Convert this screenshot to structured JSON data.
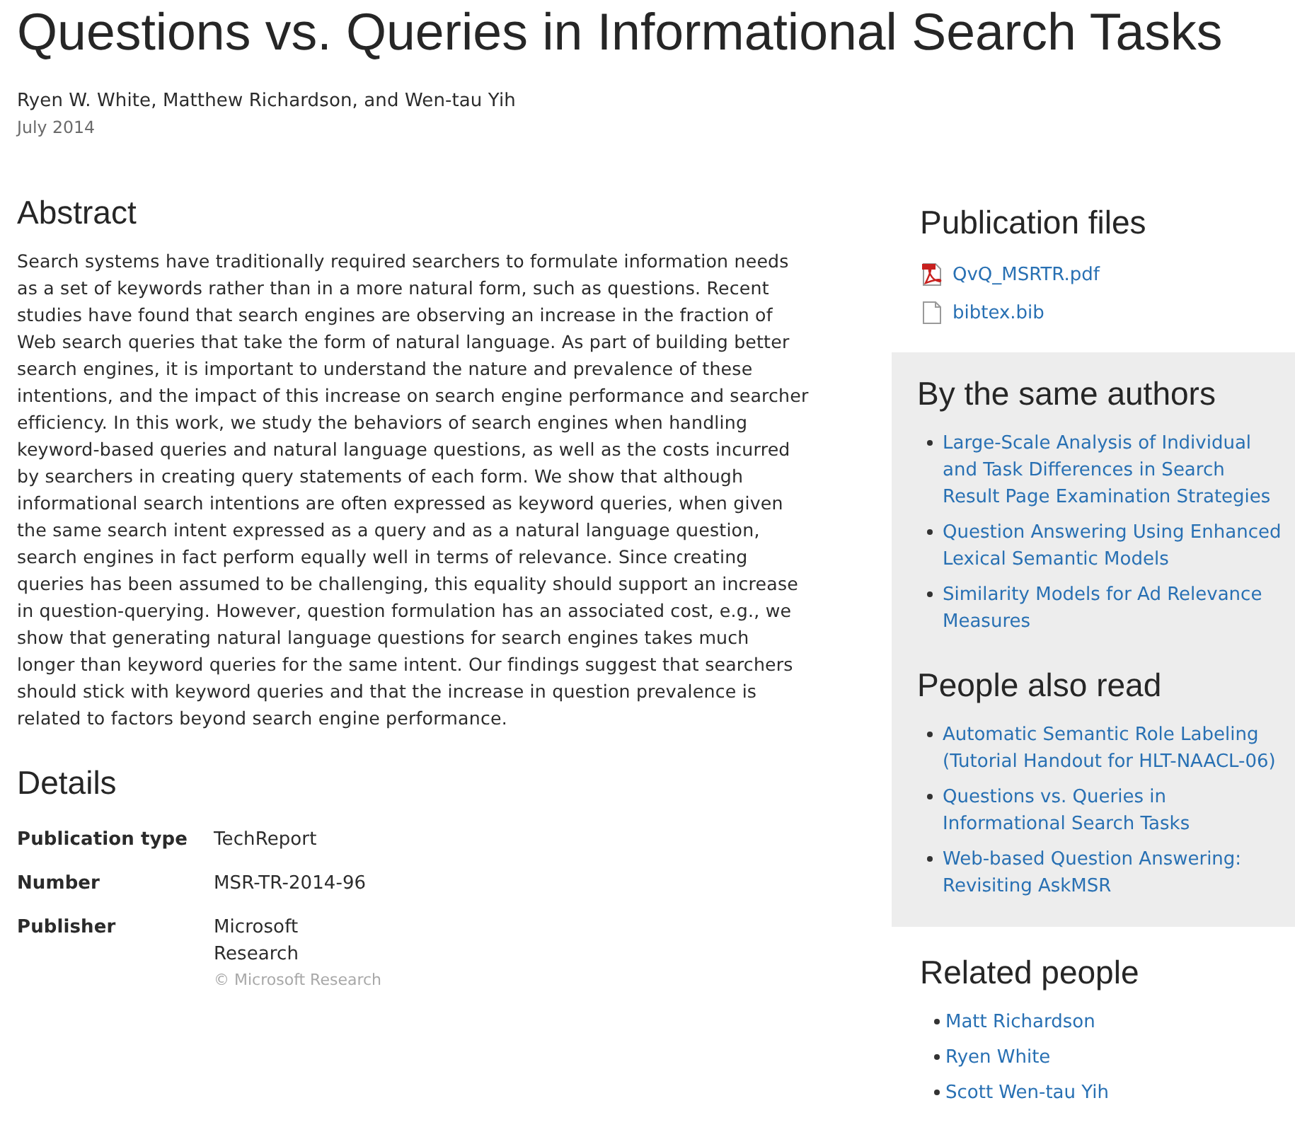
{
  "title": "Questions vs. Queries in Informational Search Tasks",
  "authors": "Ryen W. White, Matthew Richardson, and Wen-tau Yih",
  "date": "July 2014",
  "abstract": {
    "heading": "Abstract",
    "text": "Search systems have traditionally required searchers to formulate information needs as a set of keywords rather than in a more natural form, such as questions. Recent studies have found that search engines are observing an increase in the fraction of Web search queries that take the form of natural language. As part of building better search engines, it is important to understand the nature and prevalence of these intentions, and the impact of this increase on search engine performance and searcher efficiency. In this work, we study the behaviors of search engines when handling keyword-based queries and natural language questions, as well as the costs incurred by searchers in creating query statements of each form. We show that although informational search intentions are often expressed as keyword queries, when given the same search intent expressed as a query and as a natural language question, search engines in fact perform equally well in terms of relevance. Since creating queries has been assumed to be challenging, this equality should support an increase in question-querying. However, question formulation has an associated cost, e.g., we show that generating natural language questions for search engines takes much longer than keyword queries for the same intent. Our findings suggest that searchers should stick with keyword queries and that the increase in question prevalence is related to factors beyond search engine performance."
  },
  "details": {
    "heading": "Details",
    "rows": [
      {
        "label": "Publication type",
        "value": "TechReport"
      },
      {
        "label": "Number",
        "value": "MSR-TR-2014-96"
      },
      {
        "label": "Publisher",
        "value": "Microsoft Research",
        "note": "© Microsoft Research"
      }
    ]
  },
  "publication_files": {
    "heading": "Publication files",
    "files": [
      {
        "name": "QvQ_MSRTR.pdf",
        "kind": "pdf"
      },
      {
        "name": "bibtex.bib",
        "kind": "document"
      }
    ]
  },
  "by_the_same_authors": {
    "heading": "By the same authors",
    "items": [
      "Large-Scale Analysis of Individual and Task Differences in Search Result Page Examination Strategies",
      "Question Answering Using Enhanced Lexical Semantic Models",
      "Similarity Models for Ad Relevance Measures"
    ]
  },
  "people_also_read": {
    "heading": "People also read",
    "items": [
      "Automatic Semantic Role Labeling (Tutorial Handout for HLT-NAACL-06)",
      "Questions vs. Queries in Informational Search Tasks",
      "Web-based Question Answering: Revisiting AskMSR"
    ]
  },
  "related_people": {
    "heading": "Related people",
    "items": [
      "Matt Richardson",
      "Ryen White",
      "Scott Wen-tau Yih"
    ]
  }
}
